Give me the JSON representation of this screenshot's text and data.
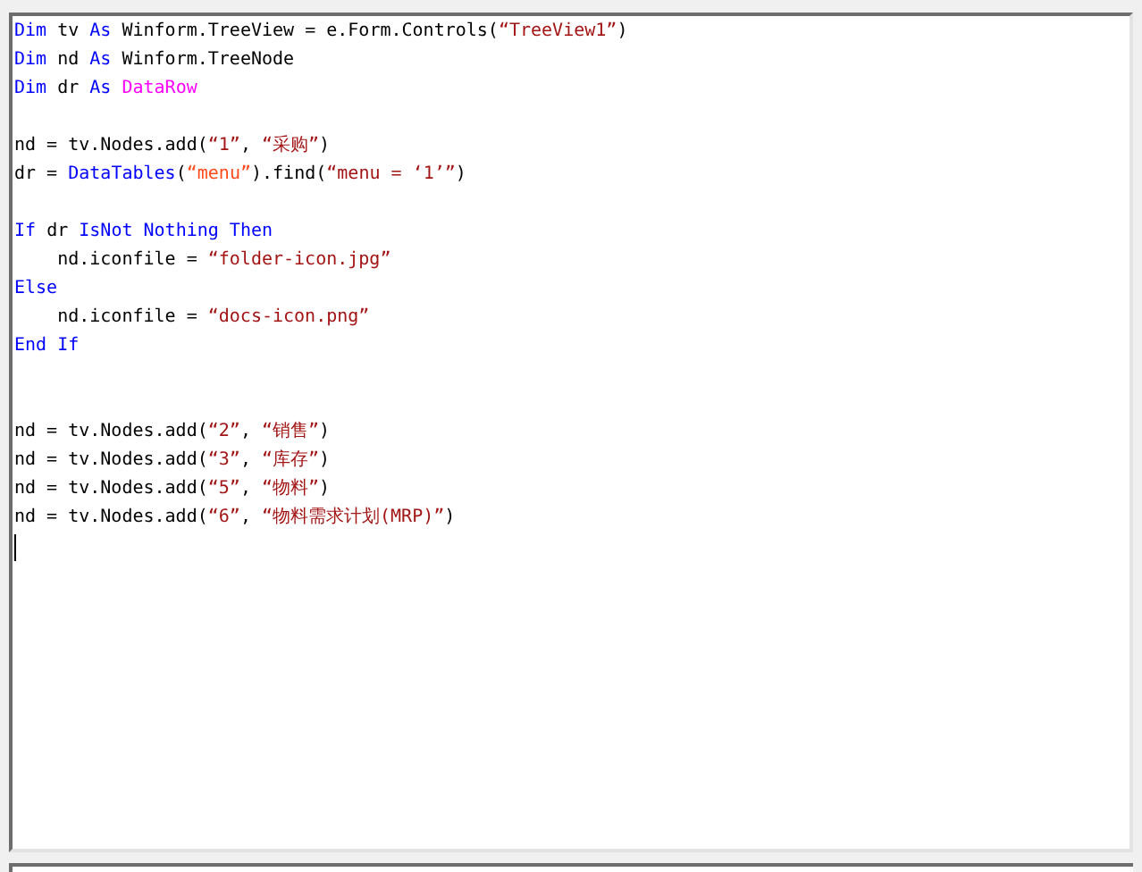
{
  "editor": {
    "lines": [
      {
        "kind": "code",
        "tokens": [
          {
            "kind": "keyword",
            "text": "Dim"
          },
          {
            "kind": "plain",
            "text": " tv "
          },
          {
            "kind": "keyword",
            "text": "As"
          },
          {
            "kind": "plain",
            "text": " Winform.TreeView = e.Form.Controls("
          },
          {
            "kind": "string",
            "text": "“TreeView1”"
          },
          {
            "kind": "plain",
            "text": ")"
          }
        ]
      },
      {
        "kind": "code",
        "tokens": [
          {
            "kind": "keyword",
            "text": "Dim"
          },
          {
            "kind": "plain",
            "text": " nd "
          },
          {
            "kind": "keyword",
            "text": "As"
          },
          {
            "kind": "plain",
            "text": " Winform.TreeNode"
          }
        ]
      },
      {
        "kind": "code",
        "tokens": [
          {
            "kind": "keyword",
            "text": "Dim"
          },
          {
            "kind": "plain",
            "text": " dr "
          },
          {
            "kind": "keyword",
            "text": "As"
          },
          {
            "kind": "type",
            "text": " DataRow"
          }
        ]
      },
      {
        "kind": "blank"
      },
      {
        "kind": "code",
        "tokens": [
          {
            "kind": "plain",
            "text": "nd = tv.Nodes.add("
          },
          {
            "kind": "string",
            "text": "“1”"
          },
          {
            "kind": "plain",
            "text": ", "
          },
          {
            "kind": "string",
            "text": "“采购”"
          },
          {
            "kind": "plain",
            "text": ")"
          }
        ]
      },
      {
        "kind": "code",
        "tokens": [
          {
            "kind": "plain",
            "text": "dr = "
          },
          {
            "kind": "keyword",
            "text": "DataTables"
          },
          {
            "kind": "plain",
            "text": "("
          },
          {
            "kind": "table",
            "text": "“menu”"
          },
          {
            "kind": "plain",
            "text": ").find("
          },
          {
            "kind": "string",
            "text": "“menu = ‘1’”"
          },
          {
            "kind": "plain",
            "text": ")"
          }
        ]
      },
      {
        "kind": "blank"
      },
      {
        "kind": "code",
        "tokens": [
          {
            "kind": "keyword",
            "text": "If"
          },
          {
            "kind": "plain",
            "text": " dr "
          },
          {
            "kind": "keyword",
            "text": "IsNot Nothing Then"
          }
        ]
      },
      {
        "kind": "code",
        "tokens": [
          {
            "kind": "plain",
            "text": "    nd.iconfile = "
          },
          {
            "kind": "string",
            "text": "“folder-icon.jpg”"
          }
        ]
      },
      {
        "kind": "code",
        "tokens": [
          {
            "kind": "keyword",
            "text": "Else"
          }
        ]
      },
      {
        "kind": "code",
        "tokens": [
          {
            "kind": "plain",
            "text": "    nd.iconfile = "
          },
          {
            "kind": "string",
            "text": "“docs-icon.png”"
          }
        ]
      },
      {
        "kind": "code",
        "tokens": [
          {
            "kind": "keyword",
            "text": "End If"
          }
        ]
      },
      {
        "kind": "blank"
      },
      {
        "kind": "blank"
      },
      {
        "kind": "code",
        "tokens": [
          {
            "kind": "plain",
            "text": "nd = tv.Nodes.add("
          },
          {
            "kind": "string",
            "text": "“2”"
          },
          {
            "kind": "plain",
            "text": ", "
          },
          {
            "kind": "string",
            "text": "“销售”"
          },
          {
            "kind": "plain",
            "text": ")"
          }
        ]
      },
      {
        "kind": "code",
        "tokens": [
          {
            "kind": "plain",
            "text": "nd = tv.Nodes.add("
          },
          {
            "kind": "string",
            "text": "“3”"
          },
          {
            "kind": "plain",
            "text": ", "
          },
          {
            "kind": "string",
            "text": "“库存”"
          },
          {
            "kind": "plain",
            "text": ")"
          }
        ]
      },
      {
        "kind": "code",
        "tokens": [
          {
            "kind": "plain",
            "text": "nd = tv.Nodes.add("
          },
          {
            "kind": "string",
            "text": "“5”"
          },
          {
            "kind": "plain",
            "text": ", "
          },
          {
            "kind": "string",
            "text": "“物料”"
          },
          {
            "kind": "plain",
            "text": ")"
          }
        ]
      },
      {
        "kind": "code",
        "tokens": [
          {
            "kind": "plain",
            "text": "nd = tv.Nodes.add("
          },
          {
            "kind": "string",
            "text": "“6”"
          },
          {
            "kind": "plain",
            "text": ", "
          },
          {
            "kind": "string",
            "text": "“物料需求计划(MRP)”"
          },
          {
            "kind": "plain",
            "text": ")"
          }
        ]
      }
    ]
  }
}
